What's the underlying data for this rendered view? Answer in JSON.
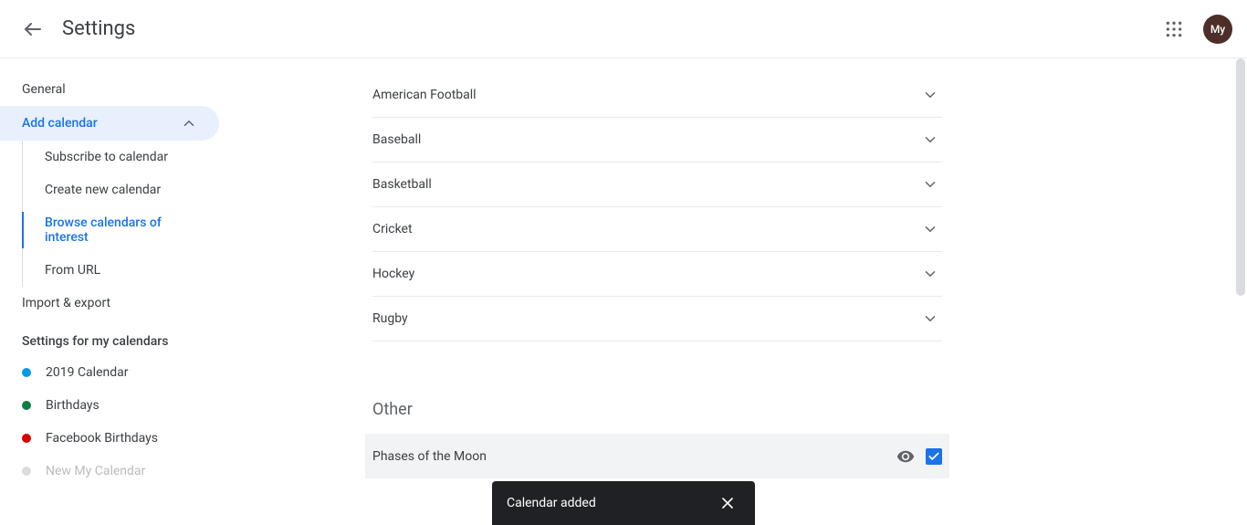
{
  "header": {
    "title": "Settings",
    "avatar": "My"
  },
  "sidebar": {
    "general": "General",
    "add_calendar": "Add calendar",
    "subs": {
      "subscribe": "Subscribe to calendar",
      "create": "Create new calendar",
      "browse": "Browse calendars of interest",
      "from_url": "From URL"
    },
    "import_export": "Import & export",
    "settings_heading": "Settings for my calendars",
    "calendars": [
      {
        "label": "2019 Calendar",
        "color": "#039be5"
      },
      {
        "label": "Birthdays",
        "color": "#0b8043"
      },
      {
        "label": "Facebook Birthdays",
        "color": "#d50000"
      },
      {
        "label": "New My Calendar",
        "color": "#9e9e9e"
      }
    ]
  },
  "main": {
    "sports": [
      "American Football",
      "Baseball",
      "Basketball",
      "Cricket",
      "Hockey",
      "Rugby"
    ],
    "other_heading": "Other",
    "other_item": "Phases of the Moon"
  },
  "toast": {
    "message": "Calendar added"
  }
}
